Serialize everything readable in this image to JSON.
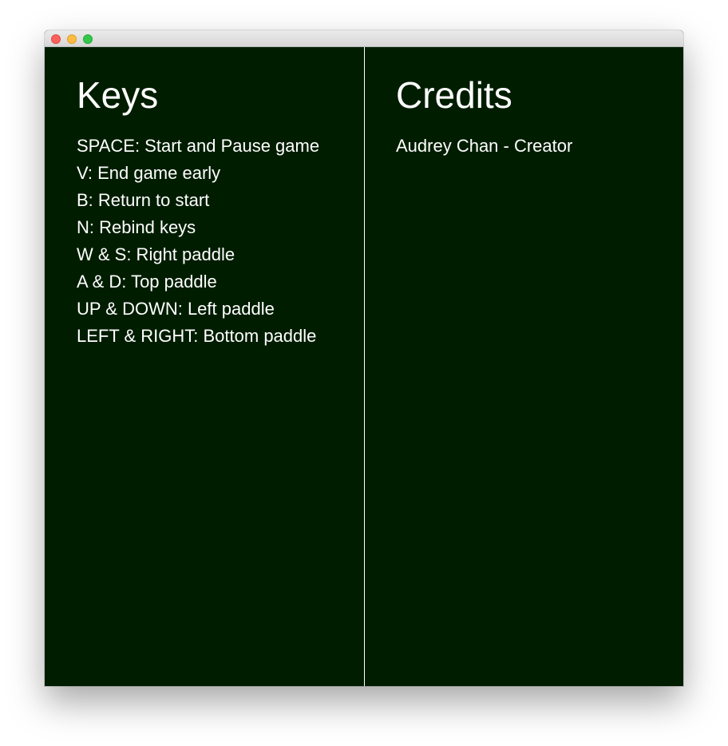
{
  "window": {
    "controls": [
      "close",
      "minimize",
      "zoom"
    ]
  },
  "keys_panel": {
    "title": "Keys",
    "bindings": [
      "SPACE: Start and Pause game",
      "V: End game early",
      "B: Return to start",
      "N: Rebind keys",
      "W & S: Right paddle",
      "A & D: Top paddle",
      "UP & DOWN: Left paddle",
      "LEFT & RIGHT: Bottom paddle"
    ]
  },
  "credits_panel": {
    "title": "Credits",
    "entries": [
      "Audrey Chan - Creator"
    ]
  },
  "colors": {
    "background": "#001d00",
    "text": "#ffffff",
    "divider": "#ffffff"
  }
}
